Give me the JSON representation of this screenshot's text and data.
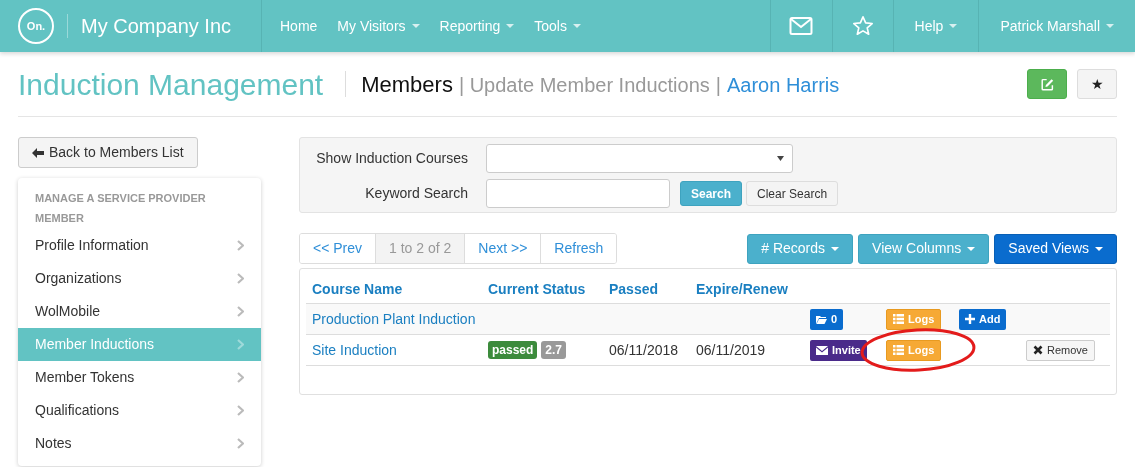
{
  "navbar": {
    "logo": "On.",
    "company": "My Company Inc",
    "menu": [
      {
        "label": "Home",
        "dropdown": false
      },
      {
        "label": "My Visitors",
        "dropdown": true
      },
      {
        "label": "Reporting",
        "dropdown": true
      },
      {
        "label": "Tools",
        "dropdown": true
      }
    ],
    "right": [
      {
        "kind": "mail"
      },
      {
        "kind": "star"
      },
      {
        "kind": "menu",
        "label": "Help"
      },
      {
        "kind": "menu",
        "label": "Patrick Marshall"
      }
    ]
  },
  "header": {
    "title": "Induction Management",
    "crumbs": [
      {
        "text": "Members",
        "kind": "current"
      },
      {
        "text": "| Update Member Inductions",
        "kind": "muted"
      },
      {
        "text": "|",
        "kind": "separator"
      },
      {
        "text": "Aaron Harris",
        "kind": "link"
      }
    ],
    "buttons": [
      {
        "kind": "edit"
      },
      {
        "kind": "favorite",
        "label": "★"
      }
    ]
  },
  "sidebar": {
    "back_button": "Back to Members List",
    "heading": "MANAGE A SERVICE PROVIDER MEMBER",
    "items": [
      {
        "label": "Profile Information",
        "selected": false
      },
      {
        "label": "Organizations",
        "selected": false
      },
      {
        "label": "WolMobile",
        "selected": false
      },
      {
        "label": "Member Inductions",
        "selected": true
      },
      {
        "label": "Member Tokens",
        "selected": false
      },
      {
        "label": "Qualifications",
        "selected": false
      },
      {
        "label": "Notes",
        "selected": false
      }
    ]
  },
  "filters": {
    "course_label": "Show Induction Courses",
    "keyword_label": "Keyword Search",
    "search_button": "Search",
    "clear_button": "Clear Search"
  },
  "pager": [
    {
      "label": "<< Prev",
      "disabled": false
    },
    {
      "label": "1 to 2 of 2",
      "disabled": true
    },
    {
      "label": "Next >>",
      "disabled": false
    },
    {
      "label": "Refresh",
      "disabled": false
    }
  ],
  "toolbar": [
    {
      "label": "# Records",
      "kind": "info"
    },
    {
      "label": "View Columns",
      "kind": "info"
    },
    {
      "label": "Saved Views",
      "kind": "primary"
    }
  ],
  "table": {
    "columns": [
      "Course Name",
      "Current Status",
      "Passed",
      "Expire/Renew"
    ],
    "rows": [
      {
        "name": "Production Plant Induction",
        "actions": [
          {
            "kind": "folder",
            "label": "0"
          },
          {
            "kind": "logs",
            "label": "Logs"
          },
          {
            "kind": "add",
            "label": "Add"
          }
        ]
      },
      {
        "name": "Site Induction",
        "badges": [
          {
            "text": "passed",
            "color": "#3c8b3c"
          },
          {
            "text": "2.7",
            "color": "#999999"
          }
        ],
        "passed": "06/11/2018",
        "expire": "06/11/2019",
        "actions": [
          {
            "kind": "invite",
            "label": "Invite"
          },
          {
            "kind": "logs",
            "label": "Logs"
          },
          {
            "kind": "remove",
            "label": "Remove"
          }
        ]
      }
    ]
  }
}
